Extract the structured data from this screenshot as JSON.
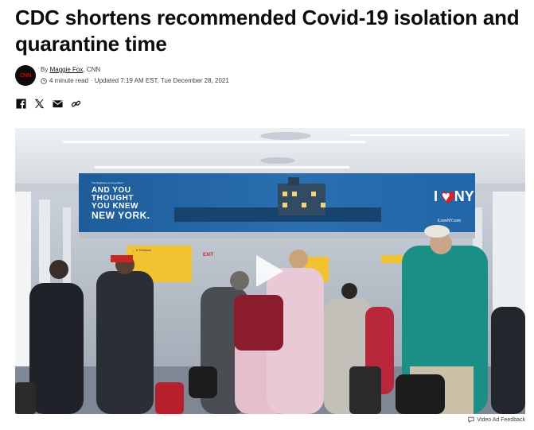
{
  "article": {
    "headline": "CDC shortens recommended Covid-19 isolation and quarantine time",
    "byline_prefix": "By",
    "author": "Maggie Fox",
    "outlet": ", CNN",
    "read_time": "4 minute read",
    "updated": "· Updated 7:19 AM EST, Tue December 28, 2021",
    "logo_text": "CNN"
  },
  "share": {
    "icons": [
      "facebook-icon",
      "x-icon",
      "email-icon",
      "link-icon"
    ]
  },
  "video": {
    "billboard": {
      "small_text": "The Neighbors of Long Island",
      "line1": "AND YOU",
      "line2": "THOUGHT",
      "line3": "YOU KNEW",
      "line4": "NEW YORK.",
      "ny_logo": "I ♥ NY",
      "url": "iLoveNY.com"
    },
    "sign_terminal": "← 5  Terminal",
    "sign_exit": "EXIT"
  },
  "footer": {
    "feedback_label": "Video Ad Feedback"
  },
  "colors": {
    "cnn_red": "#cc0000",
    "billboard_blue": "#1f5f9e",
    "sign_yellow": "#f2c230"
  }
}
